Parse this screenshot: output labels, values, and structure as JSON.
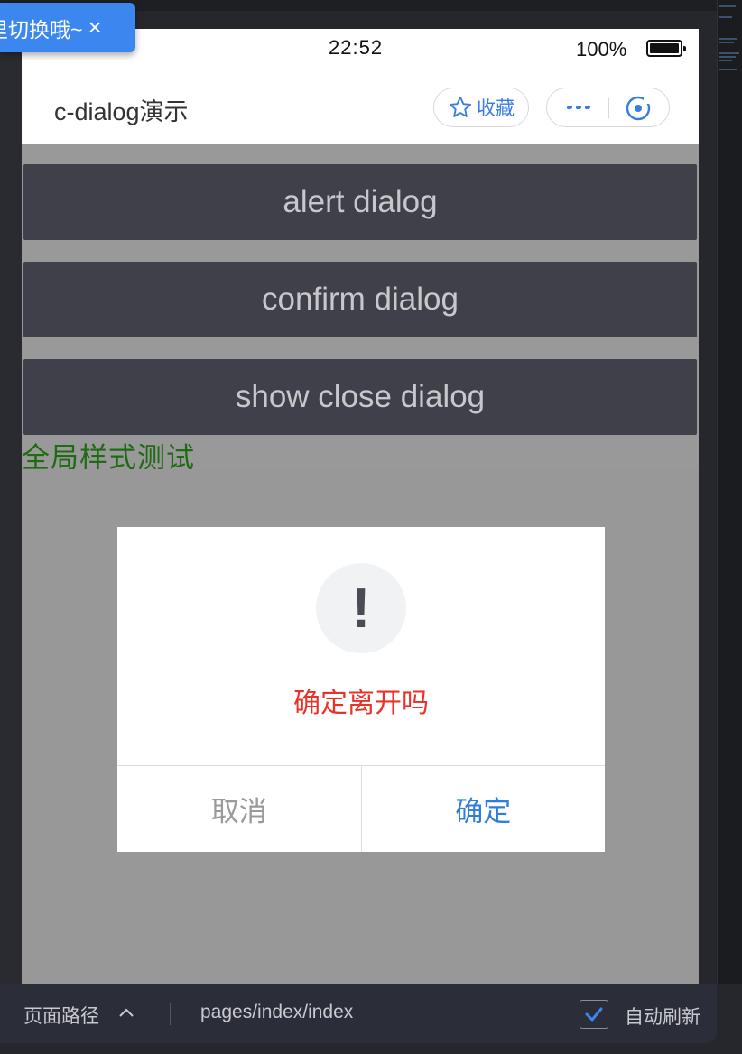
{
  "toast": {
    "text": "里切换哦~",
    "close": "×"
  },
  "status_bar": {
    "time": "22:52",
    "battery": "100%"
  },
  "navbar": {
    "title": "c-dialog演示",
    "favorite_label": "收藏"
  },
  "demo_buttons": [
    "alert dialog",
    "confirm dialog",
    "show close dialog"
  ],
  "global_style_label": "全局样式测试",
  "dialog": {
    "icon_glyph": "!",
    "message": "确定离开吗",
    "cancel_label": "取消",
    "confirm_label": "确定"
  },
  "bottom_bar": {
    "path_label": "页面路径",
    "path": "pages/index/index",
    "auto_refresh_label": "自动刷新",
    "auto_refresh_checked": true
  },
  "colors": {
    "accent_blue": "#3a7ce0",
    "dialog_message": "#e8322a",
    "global_style_text": "#1e6b14",
    "demo_button_bg": "#3f404a"
  }
}
